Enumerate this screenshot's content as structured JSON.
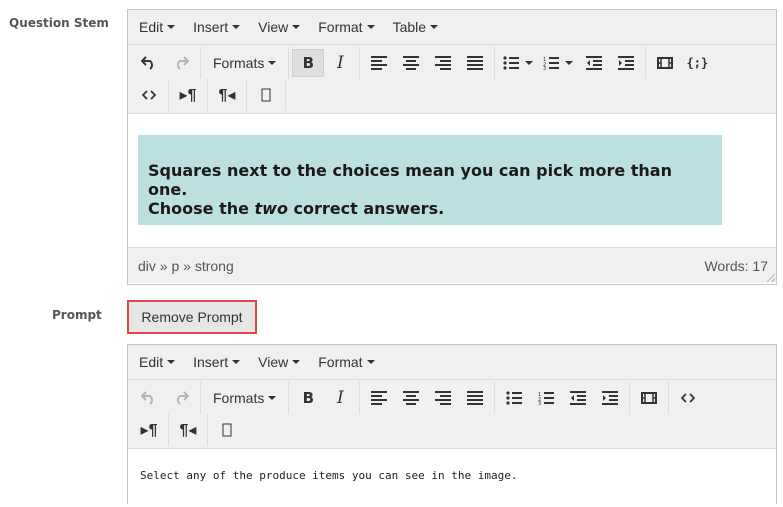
{
  "question_stem": {
    "label": "Question Stem",
    "menu": [
      "Edit",
      "Insert",
      "View",
      "Format",
      "Table"
    ],
    "formats_label": "Formats",
    "content": {
      "line1": "Squares next to the choices mean you can pick more than one.",
      "line2_before": "Choose the ",
      "line2_em": "two",
      "line2_after": " correct answers."
    },
    "path": "div » p » strong",
    "word_count": "Words: 17"
  },
  "prompt": {
    "label": "Prompt",
    "remove_button": "Remove Prompt",
    "menu": [
      "Edit",
      "Insert",
      "View",
      "Format"
    ],
    "formats_label": "Formats",
    "content": "Select any of the produce items you can see in the image."
  },
  "colors": {
    "callout_bg": "#bcdfe0",
    "toolbar_bg": "#f0f0f0",
    "remove_border": "#e0464d"
  }
}
